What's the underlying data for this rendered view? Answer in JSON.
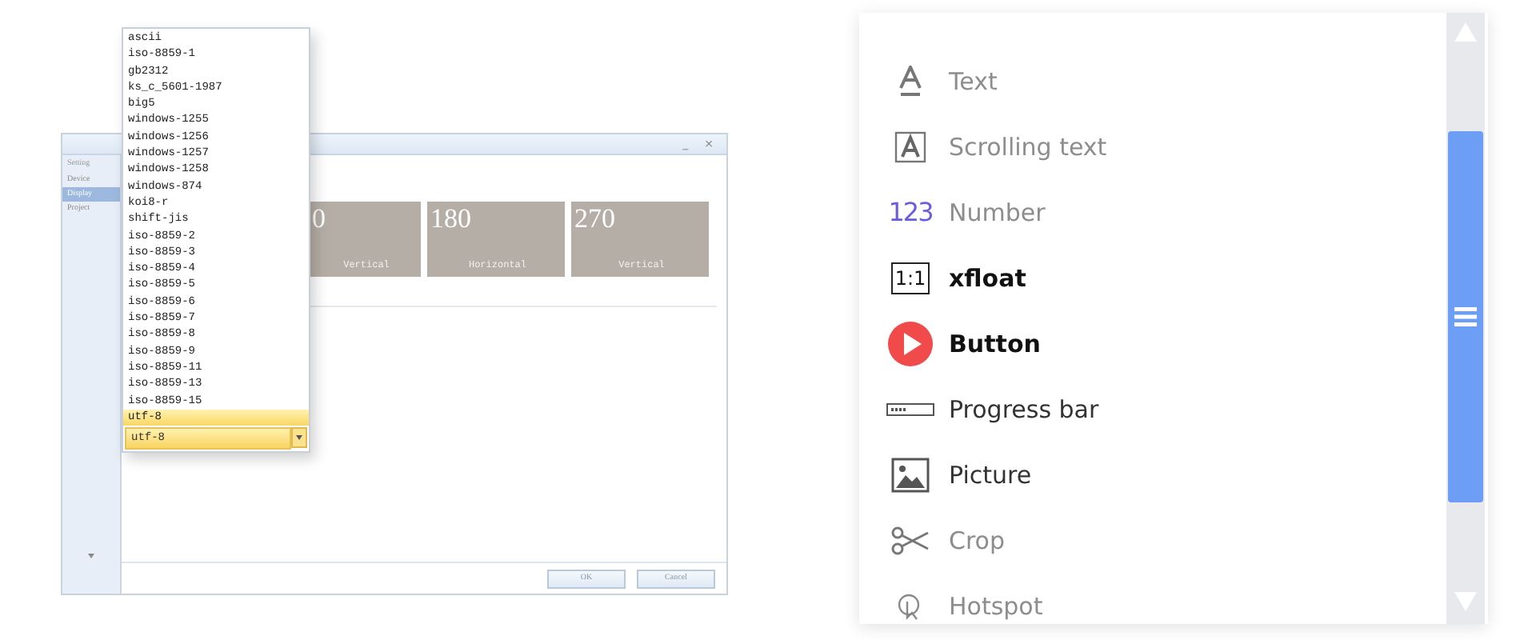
{
  "settings_window": {
    "sidebar": {
      "header": "Setting",
      "items": [
        {
          "label": "Device",
          "selected": false
        },
        {
          "label": "Display",
          "selected": true
        },
        {
          "label": "Project",
          "selected": false
        }
      ]
    },
    "title_controls": [
      "_",
      "×"
    ],
    "tiles": [
      {
        "number": "0",
        "label": "Vertical"
      },
      {
        "number": "180",
        "label": "Horizontal"
      },
      {
        "number": "270",
        "label": "Vertical"
      }
    ],
    "buttons": [
      "OK",
      "Cancel"
    ]
  },
  "encoding_dropdown": {
    "options": [
      {
        "label": "ascii",
        "selected": false
      },
      {
        "label": "iso-8859-1",
        "selected": false
      },
      {
        "label": "gb2312",
        "selected": false
      },
      {
        "label": "ks_c_5601-1987",
        "selected": false
      },
      {
        "label": "big5",
        "selected": false
      },
      {
        "label": "windows-1255",
        "selected": false
      },
      {
        "label": "windows-1256",
        "selected": false
      },
      {
        "label": "windows-1257",
        "selected": false
      },
      {
        "label": "windows-1258",
        "selected": false
      },
      {
        "label": "windows-874",
        "selected": false
      },
      {
        "label": "koi8-r",
        "selected": false
      },
      {
        "label": "shift-jis",
        "selected": false
      },
      {
        "label": "iso-8859-2",
        "selected": false
      },
      {
        "label": "iso-8859-3",
        "selected": false
      },
      {
        "label": "iso-8859-4",
        "selected": false
      },
      {
        "label": "iso-8859-5",
        "selected": false
      },
      {
        "label": "iso-8859-6",
        "selected": false
      },
      {
        "label": "iso-8859-7",
        "selected": false
      },
      {
        "label": "iso-8859-8",
        "selected": false
      },
      {
        "label": "iso-8859-9",
        "selected": false
      },
      {
        "label": "iso-8859-11",
        "selected": false
      },
      {
        "label": "iso-8859-13",
        "selected": false
      },
      {
        "label": "iso-8859-15",
        "selected": false
      },
      {
        "label": "utf-8",
        "selected": true
      }
    ],
    "value": "utf-8"
  },
  "widget_palette": {
    "items": [
      {
        "kind": "text",
        "label": "Text",
        "muted": true,
        "bold": false
      },
      {
        "kind": "scrolling",
        "label": "Scrolling text",
        "muted": true,
        "bold": false
      },
      {
        "kind": "number",
        "label": "Number",
        "icon_text": "123",
        "muted": true,
        "bold": false
      },
      {
        "kind": "ratio",
        "label": "xfloat",
        "icon_text": "1:1",
        "muted": false,
        "bold": true
      },
      {
        "kind": "button",
        "label": "Button",
        "muted": false,
        "bold": true
      },
      {
        "kind": "progress",
        "label": "Progress bar",
        "muted": false,
        "bold": false
      },
      {
        "kind": "picture",
        "label": "Picture",
        "muted": false,
        "bold": false
      },
      {
        "kind": "crop",
        "label": "Crop",
        "muted": true,
        "bold": false
      },
      {
        "kind": "hotspot",
        "label": "Hotspot",
        "muted": true,
        "bold": false
      }
    ]
  }
}
